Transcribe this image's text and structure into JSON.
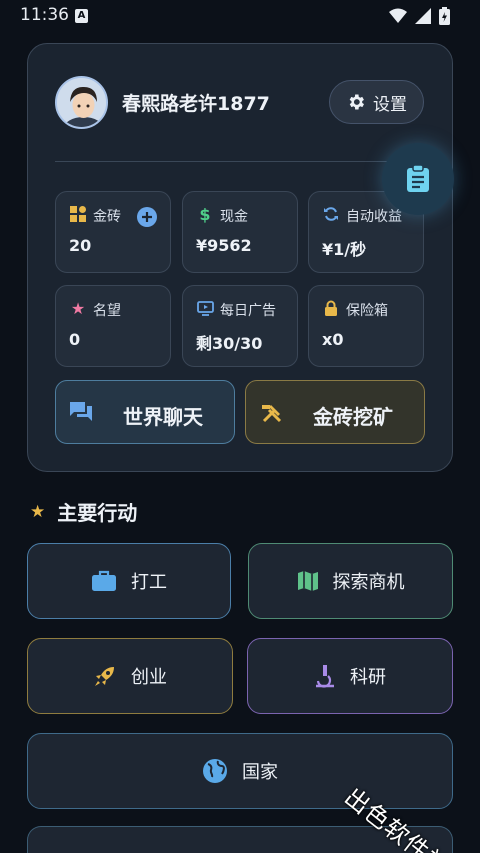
{
  "status_bar": {
    "time": "11:36",
    "notif": "A"
  },
  "profile": {
    "username": "春熙路老许1877",
    "settings_label": "设置"
  },
  "stats": [
    {
      "label": "金砖",
      "value": "20",
      "icon": "bricks-icon"
    },
    {
      "label": "现金",
      "value": "¥9562",
      "icon": "dollar-icon"
    },
    {
      "label": "自动收益",
      "value": "¥1/秒",
      "icon": "refresh-icon"
    },
    {
      "label": "名望",
      "value": "0",
      "icon": "star-icon"
    },
    {
      "label": "每日广告",
      "value": "剩30/30",
      "icon": "tv-icon"
    },
    {
      "label": "保险箱",
      "value": "x0",
      "icon": "lock-icon"
    }
  ],
  "buttons": {
    "chat": "世界聊天",
    "mining": "金砖挖矿"
  },
  "section": {
    "title": "主要行动"
  },
  "actions": {
    "work": "打工",
    "explore": "探索商机",
    "startup": "创业",
    "research": "科研",
    "country": "国家"
  },
  "watermark": "出色软件站",
  "colors": {
    "background": "#0c1119",
    "card": "#1b2430",
    "accent_blue": "#6aa7ea",
    "gold": "#e8b84a"
  }
}
